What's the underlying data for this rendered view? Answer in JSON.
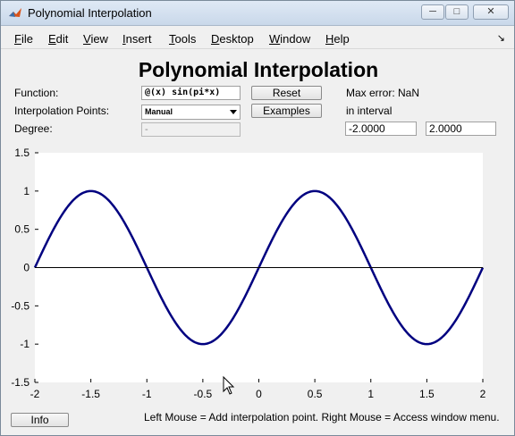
{
  "window": {
    "title": "Polynomial Interpolation",
    "controls": {
      "minimize": "─",
      "maximize": "□",
      "close": "✕"
    }
  },
  "menubar": {
    "items": [
      {
        "key": "F",
        "rest": "ile"
      },
      {
        "key": "E",
        "rest": "dit"
      },
      {
        "key": "V",
        "rest": "iew"
      },
      {
        "key": "I",
        "rest": "nsert"
      },
      {
        "key": "T",
        "rest": "ools"
      },
      {
        "key": "D",
        "rest": "esktop"
      },
      {
        "key": "W",
        "rest": "indow"
      },
      {
        "key": "H",
        "rest": "elp"
      }
    ],
    "dock_arrow": "↘"
  },
  "panel": {
    "heading": "Polynomial Interpolation",
    "function_label": "Function:",
    "function_value": "@(x) sin(pi*x)",
    "points_label": "Interpolation Points:",
    "points_value": "Manual",
    "degree_label": "Degree:",
    "degree_value": "-",
    "reset_label": "Reset",
    "examples_label": "Examples",
    "max_error_label": "Max error: NaN",
    "interval_label": "in interval",
    "interval_min": "-2.0000",
    "interval_max": "2.0000"
  },
  "footer": {
    "info_label": "Info",
    "status": "Left Mouse = Add interpolation point. Right Mouse = Access window menu."
  },
  "chart_data": {
    "type": "line",
    "series": [
      {
        "values_function": "sin(pi*x)",
        "color": "#000080",
        "x": [
          -2,
          -1.75,
          -1.5,
          -1.25,
          -1,
          -0.75,
          -0.5,
          -0.25,
          0,
          0.25,
          0.5,
          0.75,
          1,
          1.25,
          1.5,
          1.75,
          2
        ],
        "y": [
          0,
          0.7071,
          1,
          0.7071,
          0,
          -0.7071,
          -1,
          -0.7071,
          0,
          0.7071,
          1,
          0.7071,
          0,
          -0.7071,
          -1,
          -0.7071,
          0
        ]
      },
      {
        "values_function": "0",
        "color": "#000000",
        "x": [
          -2,
          2
        ],
        "y": [
          0,
          0
        ]
      }
    ],
    "xlim": [
      -2,
      2
    ],
    "ylim": [
      -1.5,
      1.5
    ],
    "xticks": [
      "-2",
      "-1.5",
      "-1",
      "-0.5",
      "0",
      "0.5",
      "1",
      "1.5",
      "2"
    ],
    "yticks": [
      "1.5",
      "1",
      "0.5",
      "0",
      "-0.5",
      "-1",
      "-1.5"
    ],
    "grid": false
  }
}
